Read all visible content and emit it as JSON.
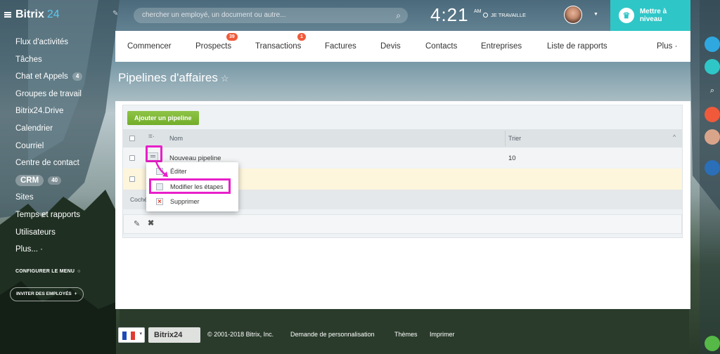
{
  "app": {
    "logo_text": "Bitrix",
    "logo_number": "24"
  },
  "sidebar": {
    "items": [
      {
        "label": "Flux d'activités",
        "badge": ""
      },
      {
        "label": "Tâches",
        "badge": ""
      },
      {
        "label": "Chat et Appels",
        "badge": "4"
      },
      {
        "label": "Groupes de travail",
        "badge": ""
      },
      {
        "label": "Bitrix24.Drive",
        "badge": ""
      },
      {
        "label": "Calendrier",
        "badge": ""
      },
      {
        "label": "Courriel",
        "badge": ""
      },
      {
        "label": "Centre de contact",
        "badge": ""
      },
      {
        "label": "CRM",
        "badge": "40"
      },
      {
        "label": "Sites",
        "badge": ""
      },
      {
        "label": "Temps et rapports",
        "badge": ""
      },
      {
        "label": "Utilisateurs",
        "badge": ""
      },
      {
        "label": "Plus... ·",
        "badge": ""
      }
    ],
    "configure_menu": "CONFIGURER LE MENU",
    "invite": "INVITER DES EMPLOYÉS"
  },
  "header": {
    "search_placeholder": "chercher un employé, un document ou autre...",
    "time": "4:21",
    "ampm": "AM",
    "status": "JE TRAVAILLE",
    "upgrade": "Mettre à niveau"
  },
  "tabs": [
    {
      "label": "Commencer",
      "count": ""
    },
    {
      "label": "Prospects",
      "count": "39"
    },
    {
      "label": "Transactions",
      "count": "1"
    },
    {
      "label": "Factures",
      "count": ""
    },
    {
      "label": "Devis",
      "count": ""
    },
    {
      "label": "Contacts",
      "count": ""
    },
    {
      "label": "Entreprises",
      "count": ""
    },
    {
      "label": "Liste de rapports",
      "count": ""
    },
    {
      "label": "Plus ·",
      "count": ""
    }
  ],
  "page": {
    "title": "Pipelines d'affaires"
  },
  "grid": {
    "add_button": "Ajouter un pipeline",
    "columns": [
      "Nom",
      "Trier"
    ],
    "rows": [
      {
        "name": "Nouveau pipeline",
        "sort": "10"
      }
    ],
    "footer": "Coché"
  },
  "context_menu": {
    "items": [
      "Éditer",
      "Modifier les étapes",
      "Supprimer"
    ]
  },
  "footer": {
    "brand": "Bitrix24",
    "copyright": "© 2001-2018 Bitrix, Inc.",
    "links": [
      "Demande de personnalisation",
      "Thèmes",
      "Imprimer"
    ]
  },
  "colors": {
    "accent": "#2fc6c7",
    "highlight": "#e81fc9",
    "add_button": "#7ab535",
    "badge": "#f05a3a"
  }
}
